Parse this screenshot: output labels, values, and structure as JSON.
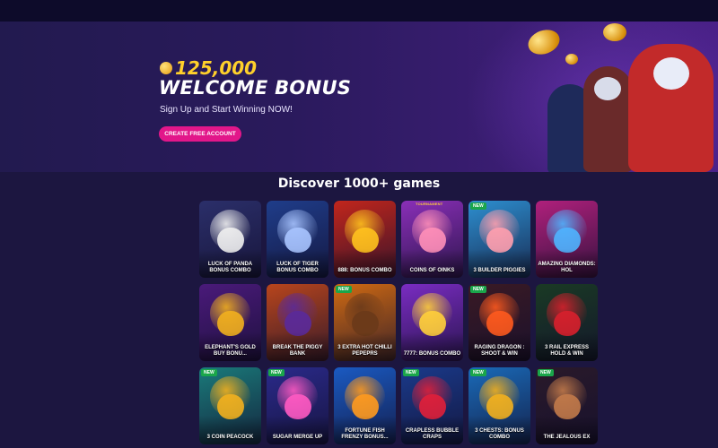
{
  "hero": {
    "bonus_amount": "125,000",
    "title": "WELCOME BONUS",
    "subtitle": "Sign Up and Start Winning NOW!",
    "cta_label": "CREATE FREE ACCOUNT"
  },
  "games_section": {
    "title": "Discover 1000+ games",
    "tiles": [
      {
        "label": "LUCK OF PANDA BONUS COMBO",
        "badge": "",
        "bg": "#2b2f6a",
        "accent": "#f0f0f0"
      },
      {
        "label": "LUCK OF TIGER BONUS COMBO",
        "badge": "",
        "bg": "#1f3d8a",
        "accent": "#a8c4ff"
      },
      {
        "label": "888: BONUS COMBO",
        "badge": "",
        "bg": "#c2261c",
        "accent": "#ffc21e"
      },
      {
        "label": "COINS OF OINKS",
        "badge": "TOURNAMENT",
        "bg": "#8a2fb8",
        "accent": "#ff8fb8"
      },
      {
        "label": "3 BUILDER PIGGIES",
        "badge": "NEW",
        "bg": "#2d8fd0",
        "accent": "#ff9fae"
      },
      {
        "label": "AMAZING DIAMONDS: HOL",
        "badge": "",
        "bg": "#b0207c",
        "accent": "#4fb4ff"
      },
      {
        "label": "ELEPHANT'S GOLD BUY BONU...",
        "badge": "",
        "bg": "#4a1a7a",
        "accent": "#f2b01e"
      },
      {
        "label": "BREAK THE PIGGY BANK",
        "badge": "",
        "bg": "#b8451c",
        "accent": "#5a2a9a"
      },
      {
        "label": "3 EXTRA HOT CHILLI PEPEPRS",
        "badge": "NEW",
        "bg": "#d06a12",
        "accent": "#6a3a1a"
      },
      {
        "label": "7777: BONUS COMBO",
        "badge": "",
        "bg": "#7a2cc2",
        "accent": "#ffcf3a"
      },
      {
        "label": "RAGING DRAGON : SHOOT & WIN",
        "badge": "NEW",
        "bg": "#3a1a24",
        "accent": "#ff5a1e"
      },
      {
        "label": "3 RAIL EXPRESS HOLD & WIN",
        "badge": "",
        "bg": "#1a3a24",
        "accent": "#d8202c"
      },
      {
        "label": "3 COIN PEACOCK",
        "badge": "NEW",
        "bg": "#1a7a7a",
        "accent": "#f2b01e"
      },
      {
        "label": "SUGAR MERGE UP",
        "badge": "NEW",
        "bg": "#2a2a8a",
        "accent": "#ff5ac2"
      },
      {
        "label": "FORTUNE FISH FRENZY BONUS...",
        "badge": "",
        "bg": "#1a5ac2",
        "accent": "#ff9a1e"
      },
      {
        "label": "CRAPLESS BUBBLE CRAPS",
        "badge": "NEW",
        "bg": "#1a3a8a",
        "accent": "#e0203a"
      },
      {
        "label": "3 CHESTS: BONUS COMBO",
        "badge": "NEW",
        "bg": "#1a6ab8",
        "accent": "#f2b01e"
      },
      {
        "label": "THE JEALOUS EX",
        "badge": "NEW",
        "bg": "#2a1a2a",
        "accent": "#c27a4a"
      }
    ]
  }
}
